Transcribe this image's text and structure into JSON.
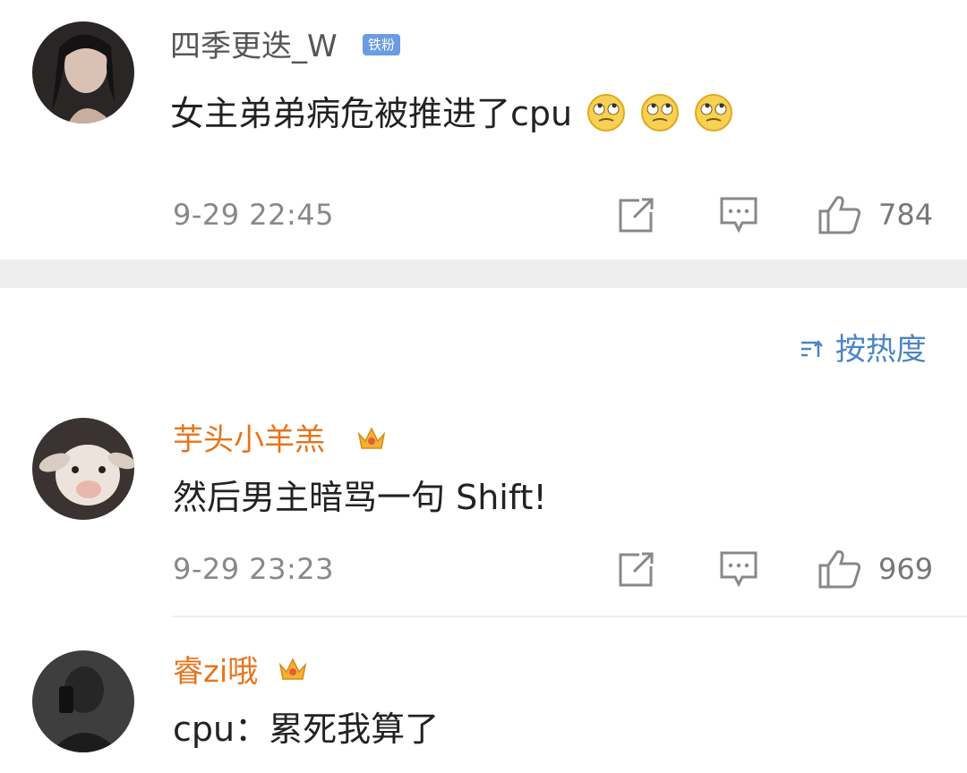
{
  "comments": [
    {
      "username": "四季更迭_W",
      "badge": "铁粉",
      "text": "女主弟弟病危被推进了cpu",
      "emoji": [
        "rolling-eyes-emoji",
        "rolling-eyes-emoji",
        "rolling-eyes-emoji"
      ],
      "time": "9-29 22:45",
      "likes": "784"
    },
    {
      "username": "芋头小羊羔",
      "text": "然后男主暗骂一句 Shift!",
      "time": "9-29 23:23",
      "likes": "969"
    },
    {
      "username": "睿zi哦",
      "text": "cpu：累死我算了"
    }
  ],
  "sort": {
    "label": "按热度",
    "icon": "sort-icon"
  },
  "colors": {
    "username_vip": "#e8741c",
    "username_normal": "#555555",
    "link_blue": "#4a86c5",
    "meta_gray": "#888888",
    "divider": "#eeeeee",
    "badge_blue": "#6b9be0"
  },
  "icons": {
    "share": "share-icon",
    "comment": "comment-icon",
    "like": "thumbs-up-icon",
    "crown": "crown-badge-icon"
  }
}
